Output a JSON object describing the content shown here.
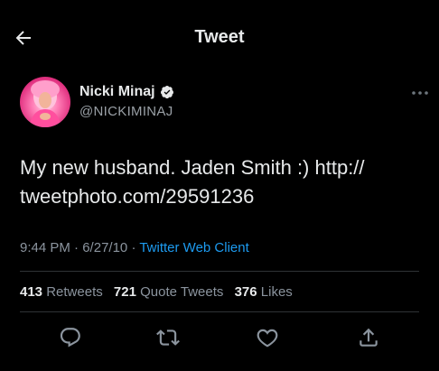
{
  "header": {
    "title": "Tweet",
    "back_icon": "arrow-left-icon"
  },
  "author": {
    "display_name": "Nicki Minaj",
    "handle": "@NICKIMINAJ",
    "verified_icon": "verified-badge-icon",
    "more_icon": "more-horizontal-icon"
  },
  "tweet": {
    "text_line1": "My new husband. Jaden Smith :)  http://",
    "text_line2": "tweetphoto.com/29591236"
  },
  "meta": {
    "time": "9:44 PM",
    "separator": "·",
    "date": "6/27/10",
    "source": "Twitter Web Client"
  },
  "stats": {
    "retweets_count": "413",
    "retweets_label": "Retweets",
    "quotes_count": "721",
    "quotes_label": "Quote Tweets",
    "likes_count": "376",
    "likes_label": "Likes"
  },
  "actions": {
    "reply_icon": "reply-icon",
    "retweet_icon": "retweet-icon",
    "like_icon": "heart-icon",
    "share_icon": "share-icon"
  },
  "colors": {
    "background": "#000000",
    "text": "#e7e9ea",
    "secondary": "#8b949e",
    "accent": "#1d9bf0",
    "divider": "#2f3336"
  }
}
